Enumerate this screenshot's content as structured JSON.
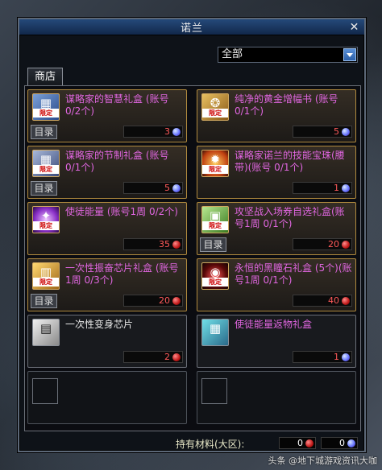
{
  "window": {
    "title": "诺兰"
  },
  "filter": {
    "selected": "全部"
  },
  "tab": {
    "label": "商店"
  },
  "items": [
    {
      "name": "谋略家的智慧礼盒 (账号 0/2个)",
      "price": "3",
      "currency": "blue-crystal-icon",
      "tag": "限定",
      "catalog": "目录",
      "color": "#e066e0"
    },
    {
      "name": "纯净的黄金增幅书 (账号 0/1个)",
      "price": "5",
      "currency": "blue-crystal-icon",
      "tag": "限定",
      "catalog": "",
      "color": "#e066e0"
    },
    {
      "name": "谋略家的节制礼盒 (账号 0/1个)",
      "price": "5",
      "currency": "blue-crystal-icon",
      "tag": "限定",
      "catalog": "目录",
      "color": "#e066e0"
    },
    {
      "name": "谋略家诺兰的技能宝珠(腰带)(账号 0/1个)",
      "price": "1",
      "currency": "blue-crystal-icon",
      "tag": "限定",
      "catalog": "",
      "color": "#e066e0"
    },
    {
      "name": "使徒能量 (账号1周 0/2个)",
      "price": "35",
      "currency": "red-stone-icon",
      "tag": "限定",
      "catalog": "",
      "color": "#e066e0"
    },
    {
      "name": "攻坚战入场券自选礼盒(账号1周 0/1个)",
      "price": "20",
      "currency": "red-stone-icon",
      "tag": "限定",
      "catalog": "目录",
      "color": "#e066e0"
    },
    {
      "name": "一次性振奋芯片礼盒 (账号1周 0/3个)",
      "price": "20",
      "currency": "red-stone-icon",
      "tag": "限定",
      "catalog": "目录",
      "color": "#e066e0"
    },
    {
      "name": "永恒的黑瞳石礼盒 (5个)(账号1周 0/1个)",
      "price": "40",
      "currency": "red-stone-icon",
      "tag": "限定",
      "catalog": "",
      "color": "#e066e0"
    },
    {
      "name": "一次性变身芯片",
      "price": "2",
      "currency": "red-stone-icon",
      "tag": "",
      "catalog": "",
      "color": "#e8e8e8"
    },
    {
      "name": "使徒能量返物礼盒",
      "price": "1",
      "currency": "blue-crystal-icon",
      "tag": "",
      "catalog": "",
      "color": "#e066e0"
    }
  ],
  "footer": {
    "label": "持有材料(大区):",
    "red_amount": "0",
    "blue_amount": "0"
  },
  "watermark": "头条 @地下城游戏资讯大咖",
  "colors": {
    "gold_border": "#b08a3e",
    "item_pink": "#e066e0",
    "price_red": "#ff5a5a",
    "titlebar": "#24497a"
  }
}
